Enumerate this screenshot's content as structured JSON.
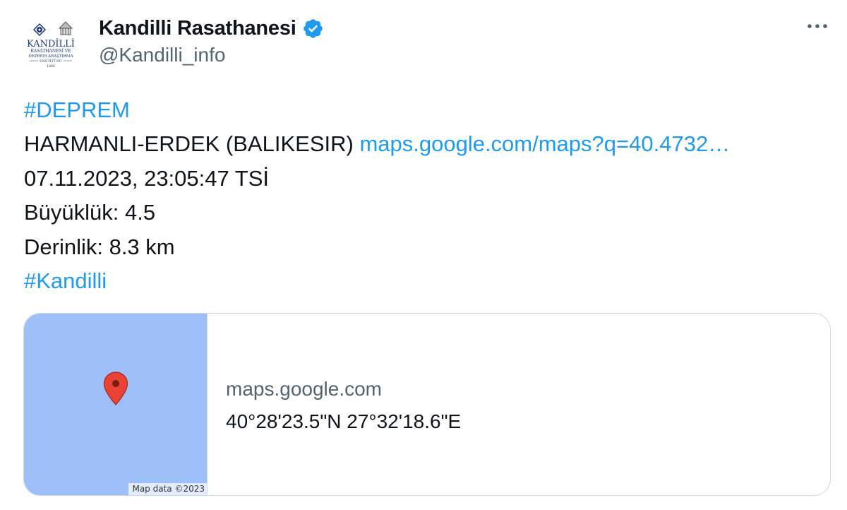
{
  "author": {
    "display_name": "Kandilli Rasathanesi",
    "handle": "@Kandilli_info",
    "verified_icon": "verified-badge-icon",
    "avatar": {
      "logo_title": "KANDİLLİ",
      "logo_line1": "RASATHANESİ VE",
      "logo_line2": "DEPREM ARAŞTIRMA",
      "logo_line3": "ENSTİTÜSÜ",
      "logo_year": "1868"
    }
  },
  "more_icon": "more-options-icon",
  "body": {
    "hashtag_1": "#DEPREM",
    "location": "HARMANLI-ERDEK (BALIKESIR) ",
    "map_link": "maps.google.com/maps?q=40.4732…",
    "datetime": "07.11.2023, 23:05:47 TSİ",
    "magnitude": "Büyüklük: 4.5",
    "depth": "Derinlik: 8.3 km",
    "hashtag_2": "#Kandilli"
  },
  "card": {
    "map_credit": "Map data ©2023",
    "domain": "maps.google.com",
    "title": "40°28'23.5\"N 27°32'18.6\"E"
  },
  "colors": {
    "link": "#1d9bf0",
    "map_water": "#9ebff7",
    "pin": "#ea4335",
    "verified": "#1d9bf0"
  }
}
